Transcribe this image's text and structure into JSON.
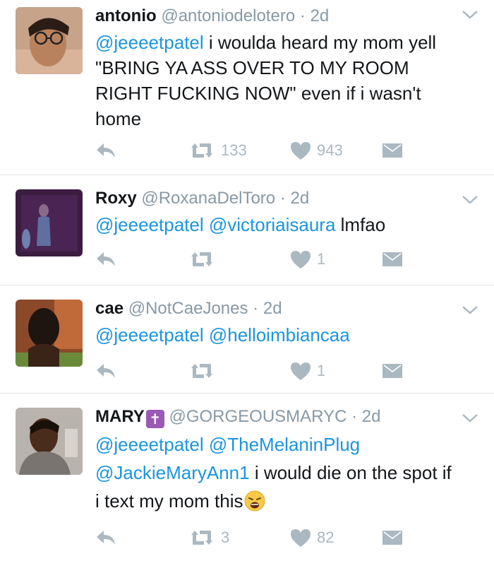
{
  "tweets": [
    {
      "name": "antonio",
      "handle": "@antoniodelotero",
      "dot": "·",
      "time": "2d",
      "body_parts": [
        {
          "type": "mention",
          "text": "@jeeeetpatel"
        },
        {
          "type": "text",
          "text": " i woulda heard my mom yell \"BRING YA ASS OVER TO MY ROOM RIGHT FUCKING NOW\" even if i wasn't home"
        }
      ],
      "retweets": "133",
      "likes": "943"
    },
    {
      "name": "Roxy",
      "handle": "@RoxanaDelToro",
      "dot": "·",
      "time": "2d",
      "body_parts": [
        {
          "type": "mention",
          "text": "@jeeeetpatel"
        },
        {
          "type": "text",
          "text": " "
        },
        {
          "type": "mention",
          "text": "@victoriaisaura"
        },
        {
          "type": "text",
          "text": " lmfao"
        }
      ],
      "retweets": "",
      "likes": "1"
    },
    {
      "name": "cae",
      "handle": "@NotCaeJones",
      "dot": "·",
      "time": "2d",
      "body_parts": [
        {
          "type": "mention",
          "text": "@jeeeetpatel"
        },
        {
          "type": "text",
          "text": " "
        },
        {
          "type": "mention",
          "text": "@helloimbiancaa"
        }
      ],
      "retweets": "",
      "likes": "1"
    },
    {
      "name": "MARY",
      "name_badge": "✝",
      "handle": "@GORGEOUSMARYC",
      "dot": "·",
      "time": "2d",
      "body_parts": [
        {
          "type": "mention",
          "text": "@jeeeetpatel"
        },
        {
          "type": "text",
          "text": " "
        },
        {
          "type": "mention",
          "text": "@TheMelaninPlug"
        },
        {
          "type": "text",
          "text": " "
        },
        {
          "type": "mention",
          "text": "@JackieMaryAnn1"
        },
        {
          "type": "text",
          "text": " i would die on the spot if i text my mom this"
        }
      ],
      "body_emoji": "weary-face-emoji",
      "retweets": "3",
      "likes": "82"
    }
  ],
  "icons": {
    "reply": "reply-icon",
    "retweet": "retweet-icon",
    "like": "heart-icon",
    "dm": "envelope-icon",
    "more": "chevron-down-icon"
  },
  "colors": {
    "mention": "#1b95e0",
    "muted": "#8899a6",
    "icon": "#aab8c2",
    "divider": "#e1e8ed"
  }
}
